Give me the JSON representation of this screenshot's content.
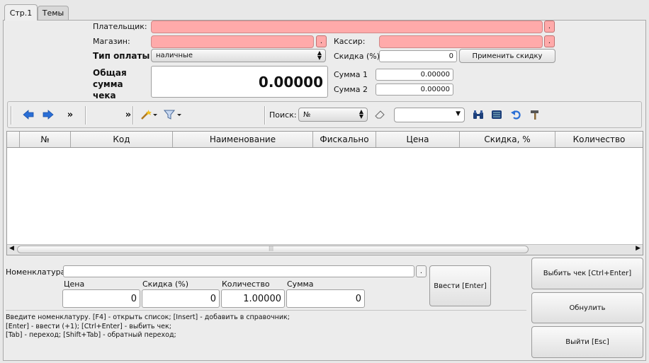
{
  "tabs": [
    {
      "label": "Стр.1",
      "active": true
    },
    {
      "label": "Темы",
      "active": false
    }
  ],
  "header": {
    "payer_label": "Плательщик:",
    "store_label": "Магазин:",
    "cashier_label": "Кассир:",
    "payment_type_label": "Тип оплаты",
    "payment_type_value": "наличные",
    "discount_label": "Скидка (%)",
    "discount_value": "0",
    "apply_discount_label": "Применить скидку",
    "total_label_1": "Общая",
    "total_label_2": "сумма",
    "total_label_3": "чека",
    "total_value": "0.00000",
    "sum1_label": "Сумма 1",
    "sum1_value": "0.00000",
    "sum2_label": "Сумма 2",
    "sum2_value": "0.00000",
    "dot_label": "."
  },
  "toolbar": {
    "more_label": "»",
    "search_label": "Поиск:",
    "search_field_value": "№",
    "search_text": ""
  },
  "table": {
    "columns": [
      "№",
      "Код",
      "Наименование",
      "Фискально",
      "Цена",
      "Скидка, %",
      "Количество"
    ],
    "rows": [],
    "scroll_grip": "|||"
  },
  "entry": {
    "nomenclature_label": "Номенклатура",
    "nomenclature_value": "",
    "price_label": "Цена",
    "price_value": "0",
    "discount_label": "Скидка (%)",
    "discount_value": "0",
    "qty_label": "Количество",
    "qty_value": "1.00000",
    "sum_label": "Сумма",
    "sum_value": "0",
    "enter_label": "Ввести [Enter]"
  },
  "actions": {
    "print_check_label": "Выбить чек [Ctrl+Enter]",
    "reset_label": "Обнулить",
    "exit_label": "Выйти [Esc]"
  },
  "hints": [
    "Введите номенклатуру. [F4] - открыть список; [Insert] - добавить в справочник;",
    "[Enter] - ввести (+1); [Ctrl+Enter] - выбить чек;",
    "[Tab] - переход; [Shift+Tab] - обратный переход;"
  ],
  "colors": {
    "required_field": "#ffaaaa",
    "default_button_border": "#5a7bb5",
    "nav_arrow": "#2a6fd6"
  }
}
